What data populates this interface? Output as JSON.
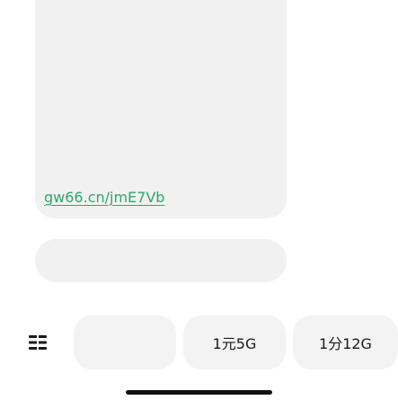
{
  "message": {
    "text": "",
    "link_prefix": "",
    "link": "gw66.cn/jmE7Vb",
    "link_suffix": ""
  },
  "action": {
    "label": ""
  },
  "quick_replies": {
    "menu_icon": "menu-grid-icon",
    "options": [
      "",
      "1元5G",
      "1分12G"
    ]
  },
  "colors": {
    "accent": "#2ea96b",
    "bubble_bg": "#f1f1f2",
    "chip_bg": "#f3f3f4"
  }
}
